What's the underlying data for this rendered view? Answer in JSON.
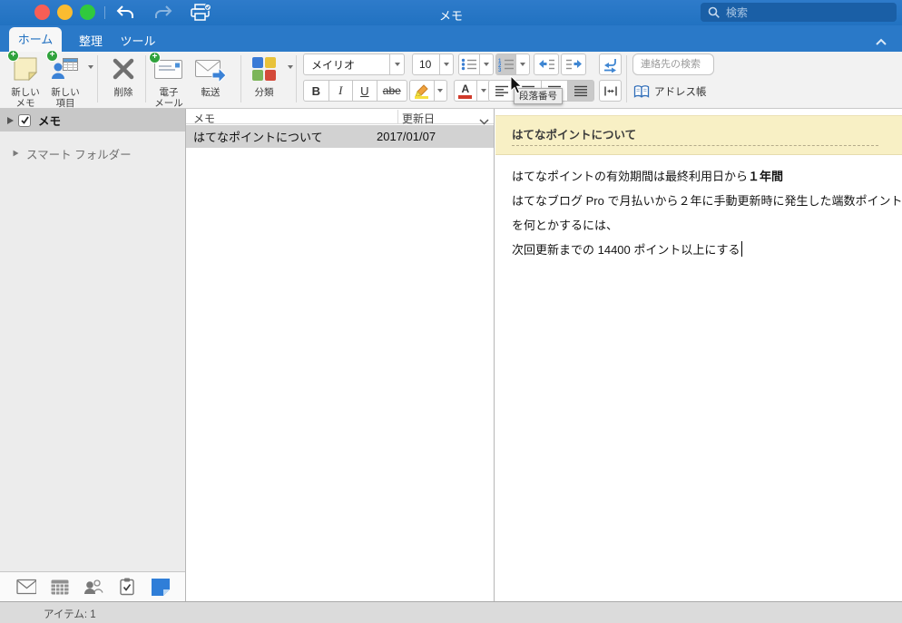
{
  "titlebar": {
    "title": "メモ",
    "search_placeholder": "検索"
  },
  "tabs": [
    {
      "label": "ホーム"
    },
    {
      "label": "整理"
    },
    {
      "label": "ツール"
    }
  ],
  "ribbon": {
    "new_note": [
      "新しい",
      "メモ"
    ],
    "new_item": [
      "新しい",
      "項目"
    ],
    "delete": "削除",
    "email": [
      "電子",
      "メール"
    ],
    "forward": "転送",
    "categorize": "分類",
    "font_name": "メイリオ",
    "font_size": "10",
    "bold": "B",
    "italic": "I",
    "underline": "U",
    "strike": "abe",
    "contact_placeholder": "連絡先の検索",
    "address_book": "アドレス帳",
    "tooltip": "段落番号"
  },
  "sidebar": {
    "memo": "メモ",
    "smart_folders": "スマート フォルダー"
  },
  "list": {
    "col_memo": "メモ",
    "col_date": "更新日",
    "rows": [
      {
        "title": "はてなポイントについて",
        "date": "2017/01/07"
      }
    ]
  },
  "note": {
    "title": "はてなポイントについて",
    "l1a": "はてなポイントの有効期間は最終利用日から",
    "l1b": "１年間",
    "l2": "はてなブログ Pro で月払いから２年に手動更新時に発生した端数ポイント",
    "l3": "を何とかするには、",
    "l4": "次回更新までの 14400 ポイント以上にする"
  },
  "status": {
    "items": "アイテム: 1"
  }
}
